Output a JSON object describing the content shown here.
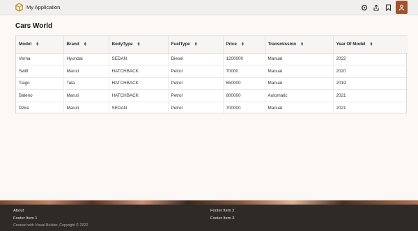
{
  "header": {
    "app_title": "My Application"
  },
  "page": {
    "title": "Cars World"
  },
  "table": {
    "columns": [
      "Model",
      "Brand",
      "BodyType",
      "FuelType",
      "Price",
      "Transmission",
      "Year Of Model"
    ],
    "rows": [
      [
        "Verna",
        "Hyundai",
        "SEDAN",
        "Diesel",
        "1200000",
        "Manual",
        "2022"
      ],
      [
        "Swift",
        "Maruti",
        "HATCHBACK",
        "Petrol",
        "70000",
        "Manual",
        "2020"
      ],
      [
        "Tiago",
        "Tata",
        "HATCHBACK",
        "Petrol",
        "650000",
        "Manual",
        "2019"
      ],
      [
        "Baleno",
        "Maruti",
        "HATCHBACK",
        "Petrol",
        "800000",
        "Automatic",
        "2021"
      ],
      [
        "Dzire",
        "Maruti",
        "SEDAN",
        "Petrol",
        "700000",
        "Manual",
        "2021"
      ]
    ]
  },
  "footer": {
    "about": "About",
    "item1": "Footer Item 1",
    "item2": "Footer Item 2",
    "item3": "Footer Item 3",
    "copyright": "Created with Visual Builder, Copyright © 2022"
  },
  "colors": {
    "avatar_bg": "#a0522d",
    "footer_bg": "#2e2a27"
  }
}
